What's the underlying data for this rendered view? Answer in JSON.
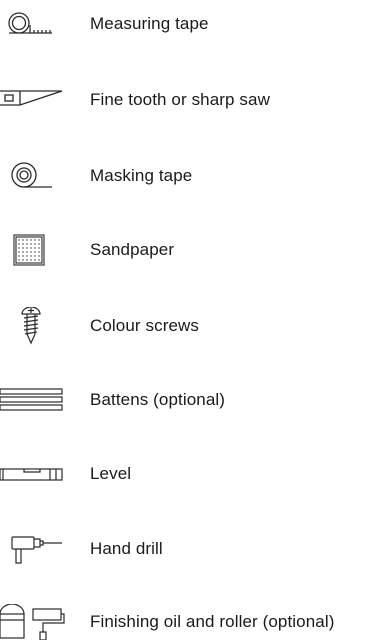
{
  "colors": {
    "text": "#1a1a1a",
    "icon_stroke": "#2a2a2a",
    "background": "#ffffff"
  },
  "tools": [
    {
      "icon": "measuring-tape-icon",
      "label": "Measuring tape"
    },
    {
      "icon": "saw-icon",
      "label": "Fine tooth or sharp saw"
    },
    {
      "icon": "masking-tape-icon",
      "label": "Masking tape"
    },
    {
      "icon": "sandpaper-icon",
      "label": "Sandpaper"
    },
    {
      "icon": "screw-icon",
      "label": "Colour screws"
    },
    {
      "icon": "battens-icon",
      "label": "Battens (optional)"
    },
    {
      "icon": "level-icon",
      "label": "Level"
    },
    {
      "icon": "hand-drill-icon",
      "label": "Hand drill"
    },
    {
      "icon": "oil-roller-icon",
      "label": "Finishing oil and roller (optional)"
    }
  ]
}
